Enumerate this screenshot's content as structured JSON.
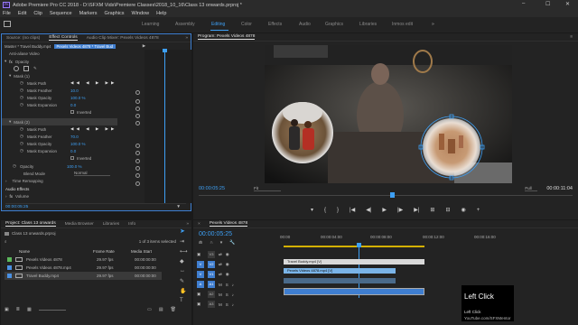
{
  "titlebar": {
    "app_icon": "Pr",
    "title": "Adobe Premiere Pro CC 2018 - D:\\SFXM Vids\\Premiere Classes\\2018_10_16\\Class 13 onwards.prproj *",
    "minimize": "–",
    "maximize": "☐",
    "close": "✕"
  },
  "menu": [
    "File",
    "Edit",
    "Clip",
    "Sequence",
    "Markers",
    "Graphics",
    "Window",
    "Help"
  ],
  "workspaces": {
    "tabs": [
      "Learning",
      "Assembly",
      "Editing",
      "Color",
      "Effects",
      "Audio",
      "Graphics",
      "Libraries",
      "Inmos edit"
    ],
    "active": "Editing",
    "more": "»"
  },
  "source_panel": {
    "tabs": [
      "Source: (no clips)",
      "Effect Controls",
      "Audio Clip Mixer: Pexels Videos 4878"
    ],
    "active_tab": "Effect Controls",
    "more": "»",
    "header_master": "Master * Travel Buddy.mp4",
    "header_clip": "Pexels Videos 4878 * Travel Bud",
    "clip_label": "Pexels Videos 4878",
    "cut_label": "Anti-aliase Video",
    "opacity_label": "Opacity",
    "masks": [
      {
        "name": "Mask (1)",
        "path_label": "Mask Path",
        "feather_label": "Mask Feather",
        "feather_value": "10.0",
        "opacity_label": "Mask Opacity",
        "opacity_value": "100.0 %",
        "expansion_label": "Mask Expansion",
        "expansion_value": "0.0",
        "inverted_label": "Inverted"
      },
      {
        "name": "Mask (2)",
        "path_label": "Mask Path",
        "feather_label": "Mask Feather",
        "feather_value": "70.0",
        "opacity_label": "Mask Opacity",
        "opacity_value": "100.0 %",
        "expansion_label": "Mask Expansion",
        "expansion_value": "0.0",
        "inverted_label": "Inverted"
      }
    ],
    "opacity_prop_label": "Opacity",
    "opacity_prop_value": "100.0 %",
    "blend_label": "Blend Mode",
    "blend_value": "Normal",
    "time_remap_label": "Time Remapping",
    "audio_effects_label": "Audio Effects",
    "volume_label": "Volume",
    "timecode": "00:00:05:25"
  },
  "program": {
    "title": "Program: Pexels Videos 4878",
    "timecode": "00:00:05:25",
    "fit": "Fit",
    "full": "Full",
    "duration": "00:00:11:04"
  },
  "project": {
    "tabs": [
      "Project: Class 13 onwards",
      "Media Browser",
      "Libraries",
      "Info"
    ],
    "more": "»",
    "file": "Class 13 onwards.prproj",
    "selection_info": "1 of 3 items selected",
    "columns": [
      "Name",
      "Frame Rate",
      "Media Start"
    ],
    "items": [
      {
        "name": "Pexels Videos 4878",
        "fps": "29.97 fps",
        "start": "00:00:00:00",
        "color": "#5cb85c"
      },
      {
        "name": "Pexels Videos 4878.mp4",
        "fps": "29.97 fps",
        "start": "00:00:00:00",
        "color": "#4a90e2"
      },
      {
        "name": "Travel Buddy.mp4",
        "fps": "29.97 fps",
        "start": "00:00:00:00",
        "color": "#4a90e2"
      }
    ]
  },
  "timeline": {
    "sequence_tab": "Pexels Videos 4878",
    "timecode": "00:00:05:25",
    "ruler": [
      "00:00",
      "00:00:04:00",
      "00:00:08:00",
      "00:00:12:00",
      "00:00:16:00"
    ],
    "tracks": [
      "V3",
      "V2",
      "V1",
      "A1",
      "A2",
      "A3"
    ],
    "clips": {
      "v3": "Travel Buddy.mp4 [V]",
      "v2": "Pexels Videos 4878.mp4 [V]",
      "v1": "",
      "a1": ""
    }
  },
  "overlay": {
    "title": "Left Click",
    "subtitle": "Left Click",
    "credit": "YouTube.com/SFXMentor"
  }
}
